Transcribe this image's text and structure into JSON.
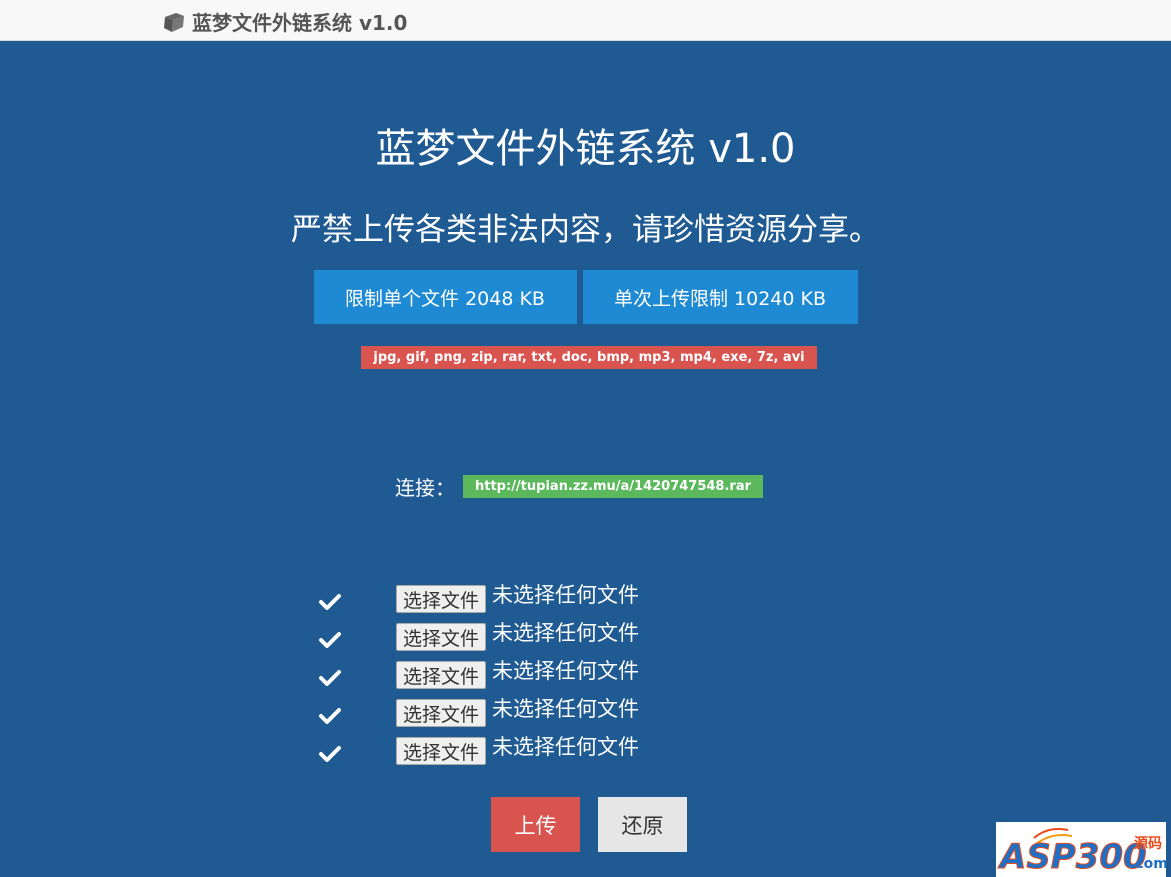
{
  "navbar": {
    "brand": "蓝梦文件外链系统 v1.0",
    "brand_icon": "cube-icon"
  },
  "main": {
    "title": "蓝梦文件外链系统 v1.0",
    "notice": "严禁上传各类非法内容，请珍惜资源分享。",
    "limits": {
      "single_file": "限制单个文件 2048 KB",
      "per_upload": "单次上传限制 10240 KB"
    },
    "allowed_types": "jpg, gif, png, zip, rar, txt, doc, bmp, mp3, mp4, exe, 7z, avi",
    "link": {
      "caption": "连接：",
      "url": "http://tupian.zz.mu/a/1420747548.rar"
    },
    "files": [
      {
        "button": "选择文件",
        "status": "未选择任何文件",
        "icon": "check-icon"
      },
      {
        "button": "选择文件",
        "status": "未选择任何文件",
        "icon": "check-icon"
      },
      {
        "button": "选择文件",
        "status": "未选择任何文件",
        "icon": "check-icon"
      },
      {
        "button": "选择文件",
        "status": "未选择任何文件",
        "icon": "check-icon"
      },
      {
        "button": "选择文件",
        "status": "未选择任何文件",
        "icon": "check-icon"
      }
    ],
    "actions": {
      "upload": "上传",
      "reset": "还原"
    }
  },
  "watermark": {
    "text": "ASP300",
    "suffix": "源码",
    "domain": ".com"
  },
  "colors": {
    "background": "#1f5a93",
    "navbar": "#f8f8f8",
    "primary": "#1e8ad3",
    "danger": "#d9534f",
    "success": "#5cb85c",
    "default": "#e6e6e6"
  }
}
